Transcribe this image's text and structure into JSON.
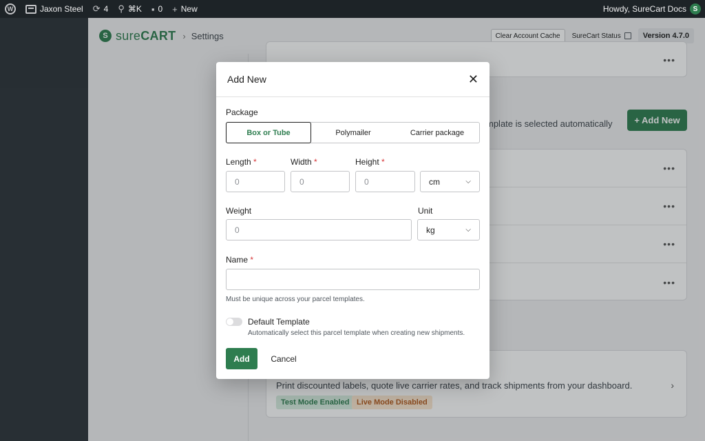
{
  "admin_bar": {
    "site_name": "Jaxon Steel",
    "updates_count": "4",
    "shortcut": "⌘K",
    "comments_count": "0",
    "new_label": "New",
    "howdy": "Howdy, SureCart Docs"
  },
  "header": {
    "brand_light": "sure",
    "brand_bold": "CART",
    "breadcrumb": "Settings",
    "clear_cache_label": "Clear Account Cache",
    "status_label": "SureCart Status",
    "version_label": "Version 4.7.0"
  },
  "background": {
    "selected_text": "mplate is selected automatically",
    "add_new_label": "Add New",
    "shipping_text": "Print discounted labels, quote live carrier rates, and track shipments from your dashboard.",
    "badge_test": "Test Mode Enabled",
    "badge_live": "Live Mode Disabled"
  },
  "modal": {
    "title": "Add New",
    "package_label": "Package",
    "package_options": [
      "Box or Tube",
      "Polymailer",
      "Carrier package"
    ],
    "package_selected": "Box or Tube",
    "length_label": "Length",
    "width_label": "Width",
    "height_label": "Height",
    "dimension_placeholder": "0",
    "dimension_unit": "cm",
    "weight_label": "Weight",
    "weight_placeholder": "0",
    "unit_label": "Unit",
    "weight_unit": "kg",
    "name_label": "Name",
    "name_help": "Must be unique across your parcel templates.",
    "default_label": "Default Template",
    "default_help": "Automatically select this parcel template when creating new shipments.",
    "default_enabled": false,
    "add_label": "Add",
    "cancel_label": "Cancel",
    "required_mark": "*"
  },
  "colors": {
    "brand_green": "#2e7d4f",
    "admin_bar": "#1d2327",
    "required": "#d63638"
  }
}
